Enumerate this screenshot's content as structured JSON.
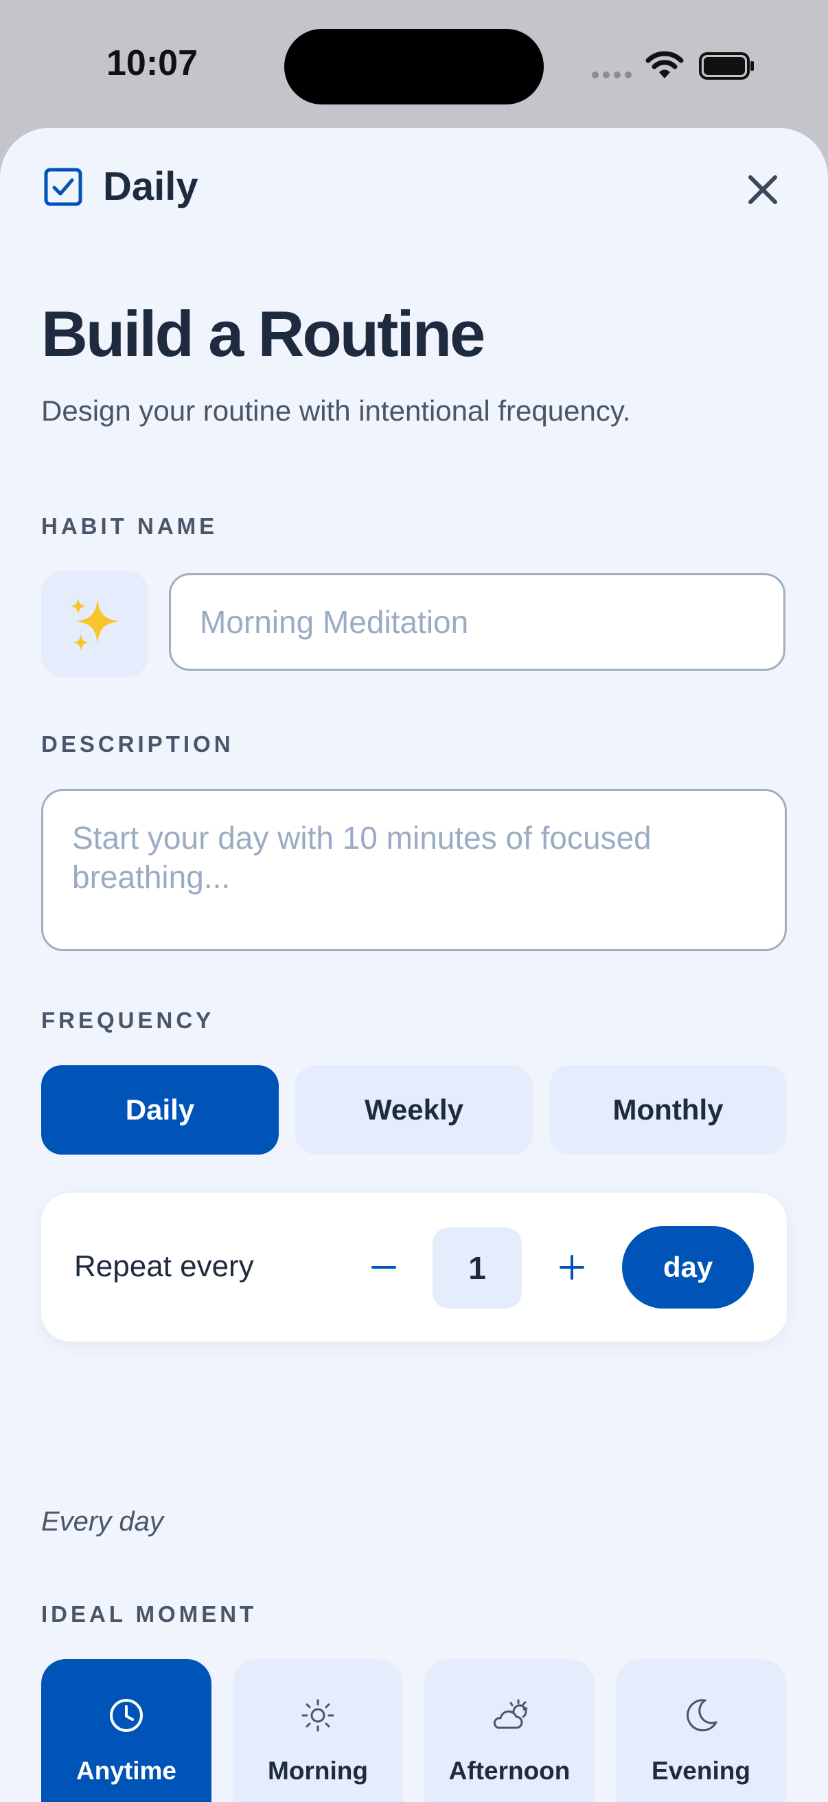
{
  "status_bar": {
    "time": "10:07"
  },
  "header": {
    "app_name": "Daily"
  },
  "page": {
    "title": "Build a Routine",
    "subtitle": "Design your routine with intentional frequency."
  },
  "habit_name": {
    "label": "HABIT NAME",
    "emoji": "✨",
    "placeholder": "Morning Meditation",
    "value": ""
  },
  "description": {
    "label": "DESCRIPTION",
    "placeholder": "Start your day with 10 minutes of focused breathing...",
    "value": ""
  },
  "frequency": {
    "label": "FREQUENCY",
    "options": [
      "Daily",
      "Weekly",
      "Monthly"
    ],
    "selected": "Daily"
  },
  "repeat": {
    "label": "Repeat every",
    "value": "1",
    "unit": "day",
    "summary": "Every day"
  },
  "ideal_moment": {
    "label": "IDEAL MOMENT",
    "options": [
      {
        "label": "Anytime",
        "icon": "clock-icon"
      },
      {
        "label": "Morning",
        "icon": "sun-icon"
      },
      {
        "label": "Afternoon",
        "icon": "partly-cloudy-icon"
      },
      {
        "label": "Evening",
        "icon": "moon-icon"
      }
    ],
    "selected": "Anytime"
  },
  "colors": {
    "accent": "#0054b8",
    "sheet_background": "#f0f4fd",
    "chip_background": "#e5ecfb",
    "text_primary": "#1e2a3e",
    "text_secondary": "#4a5568",
    "placeholder": "#9aabc4"
  }
}
